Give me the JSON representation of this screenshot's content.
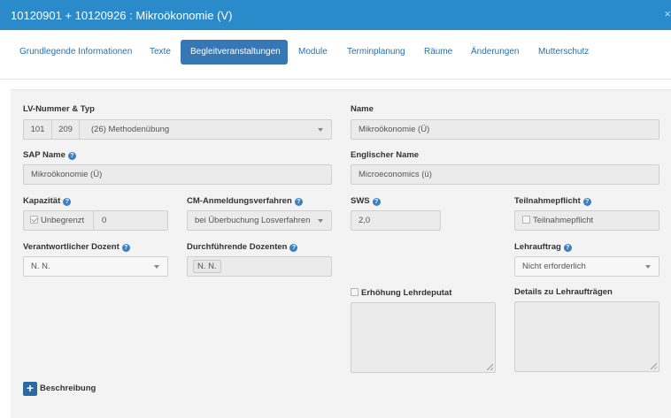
{
  "header": {
    "title": "10120901 + 10120926 : Mikroökonomie (V)",
    "close_label": "×"
  },
  "tabs": [
    {
      "label": "Grundlegende Informationen",
      "active": false
    },
    {
      "label": "Texte",
      "active": false
    },
    {
      "label": "Begleitveranstaltungen",
      "active": true
    },
    {
      "label": "Module",
      "active": false
    },
    {
      "label": "Terminplanung",
      "active": false
    },
    {
      "label": "Räume",
      "active": false
    },
    {
      "label": "Änderungen",
      "active": false
    },
    {
      "label": "Mutterschutz",
      "active": false
    }
  ],
  "form": {
    "lv_label": "LV-Nummer & Typ",
    "lv_num1": "101",
    "lv_num2": "209",
    "lv_type": "(26) Methodenübung",
    "name_label": "Name",
    "name_value": "Mikroökonomie (Ü)",
    "sap_label": "SAP Name",
    "sap_value": "Mikroökonomie (Ü)",
    "en_name_label": "Englischer Name",
    "en_name_value": "Microeconomics (ü)",
    "kapazitaet_label": "Kapazität",
    "unbegrenzt_label": "Unbegrenzt",
    "unbegrenzt_checked": true,
    "kapazitaet_value": "0",
    "cm_label": "CM-Anmeldungsverfahren",
    "cm_value": "bei Überbuchung Losverfahren",
    "sws_label": "SWS",
    "sws_value": "2,0",
    "teilnahme_label": "Teilnahmepflicht",
    "teilnahme_checkbox_label": "Teilnahmepflicht",
    "teilnahme_checked": false,
    "dozent_label": "Verantwortlicher Dozent",
    "dozent_value": "N. N.",
    "durch_label": "Durchführende Dozenten",
    "durch_tag": "N. N.",
    "lehrauftrag_label": "Lehrauftrag",
    "lehrauftrag_value": "Nicht erforderlich",
    "deputat_label": "Erhöhung Lehrdeputat",
    "deputat_checked": false,
    "details_label": "Details zu Lehraufträgen",
    "beschreibung_label": "Beschreibung",
    "help_glyph": "?",
    "plus_glyph": "+"
  },
  "colors": {
    "header_bg": "#2b8ac9",
    "active_tab_bg": "#3778b4",
    "tab_link": "#2a70a8",
    "help_icon": "#3b7fc1"
  }
}
